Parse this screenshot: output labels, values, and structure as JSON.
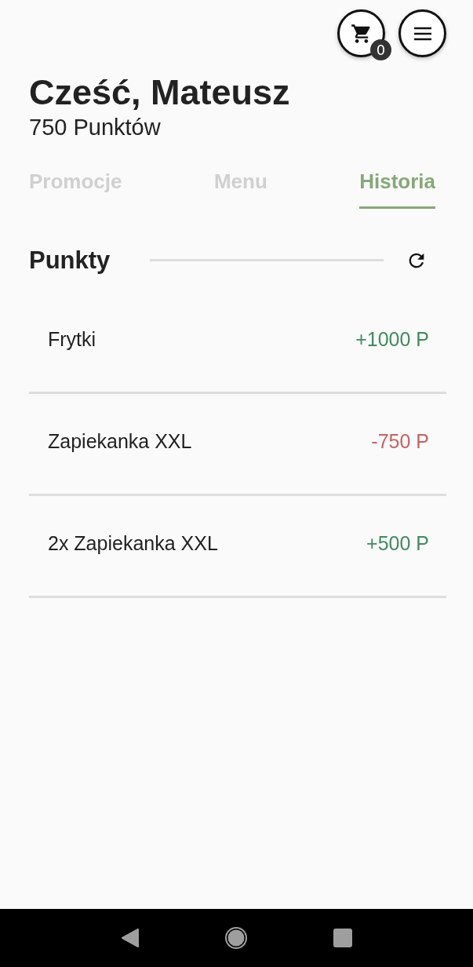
{
  "header": {
    "cart_count": "0"
  },
  "greeting": "Cześć, Mateusz",
  "points": "750 Punktów",
  "tabs": [
    {
      "label": "Promocje",
      "selected": false
    },
    {
      "label": "Menu",
      "selected": false
    },
    {
      "label": "Historia",
      "selected": true
    }
  ],
  "section": {
    "title": "Punkty"
  },
  "history": [
    {
      "name": "Frytki",
      "amount": "+1000 P",
      "color": "#3f8a5e"
    },
    {
      "name": "Zapiekanka XXL",
      "amount": "-750 P",
      "color": "#c46262"
    },
    {
      "name": "2x Zapiekanka XXL",
      "amount": "+500 P",
      "color": "#3f8a5e"
    }
  ]
}
